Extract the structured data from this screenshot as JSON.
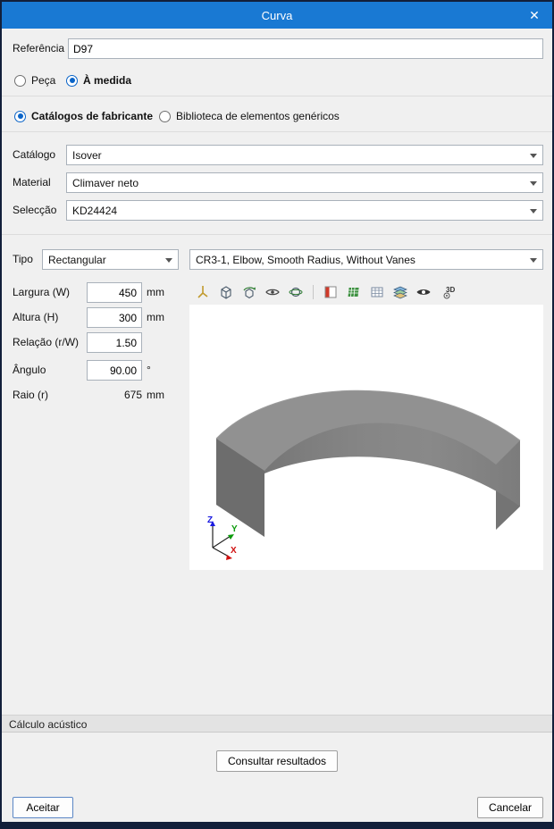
{
  "window": {
    "title": "Curva",
    "close_glyph": "✕"
  },
  "form": {
    "reference_label": "Referência",
    "reference_value": "D97",
    "mode": {
      "options": [
        {
          "label": "Peça",
          "selected": false
        },
        {
          "label": "À medida",
          "selected": true
        }
      ]
    },
    "source": {
      "options": [
        {
          "label": "Catálogos de fabricante",
          "selected": true
        },
        {
          "label": "Biblioteca de elementos genéricos",
          "selected": false
        }
      ]
    },
    "catalog_label": "Catálogo",
    "catalog_value": "Isover",
    "material_label": "Material",
    "material_value": "Climaver neto",
    "selection_label": "Selecção",
    "selection_value": "KD24424",
    "type_label": "Tipo",
    "type_value": "Rectangular",
    "model_value": "CR3-1, Elbow, Smooth Radius, Without Vanes",
    "dims": [
      {
        "label": "Largura (W)",
        "value": "450",
        "unit": "mm"
      },
      {
        "label": "Altura (H)",
        "value": "300",
        "unit": "mm"
      },
      {
        "label": "Relação (r/W)",
        "value": "1.50",
        "unit": ""
      },
      {
        "label": "Ângulo",
        "value": "90.00",
        "unit": "°"
      },
      {
        "label": "Raio (r)",
        "value": "675",
        "unit": "mm"
      }
    ]
  },
  "viewer": {
    "toolbar_icons": [
      "axes-icon",
      "cube-view-icon",
      "cube-orbit-icon",
      "eye-icon",
      "orbit-icon",
      "section-colors-icon",
      "ground-plane-icon",
      "grid-icon",
      "layers-icon",
      "visibility-bold-icon",
      "3d-config-icon"
    ],
    "badge_3d": "3D",
    "axis_labels": {
      "x": "X",
      "y": "Y",
      "z": "Z"
    }
  },
  "acoustic": {
    "header": "Cálculo acústico",
    "consult_button": "Consultar resultados"
  },
  "footer": {
    "accept": "Aceitar",
    "cancel": "Cancelar"
  },
  "colors": {
    "titlebar": "#1979d3",
    "window_border": "#121f3a",
    "selection_blue": "#0a64c8"
  }
}
